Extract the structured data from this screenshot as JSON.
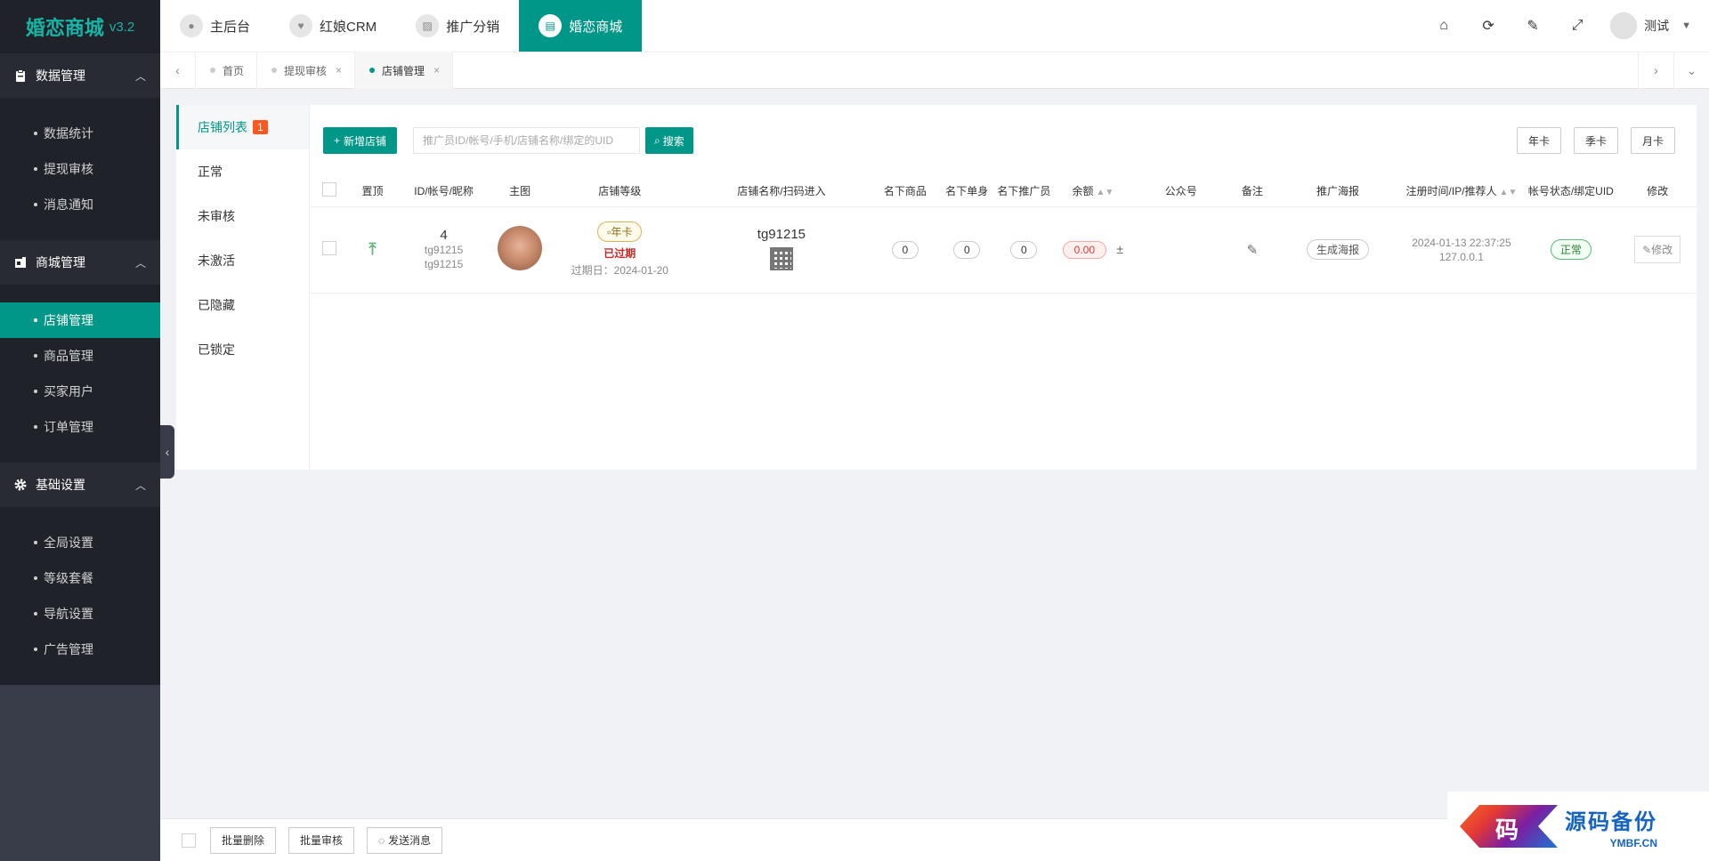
{
  "brand": {
    "name": "婚恋商城",
    "version": "v3.2"
  },
  "sidebar": {
    "groups": [
      {
        "title": "数据管理",
        "icon": "clipboard-icon",
        "items": [
          "数据统计",
          "提现审核",
          "消息通知"
        ]
      },
      {
        "title": "商城管理",
        "icon": "store-icon",
        "items": [
          "店铺管理",
          "商品管理",
          "买家用户",
          "订单管理"
        ],
        "active": "店铺管理"
      },
      {
        "title": "基础设置",
        "icon": "gear-icon",
        "items": [
          "全局设置",
          "等级套餐",
          "导航设置",
          "广告管理"
        ]
      }
    ]
  },
  "topnav": {
    "items": [
      {
        "label": "主后台",
        "icon": "user-circle-icon"
      },
      {
        "label": "红娘CRM",
        "icon": "heart-icon"
      },
      {
        "label": "推广分销",
        "icon": "chart-icon"
      },
      {
        "label": "婚恋商城",
        "icon": "shop-icon",
        "active": true
      }
    ],
    "user_name": "测试"
  },
  "tabs": [
    {
      "label": "首页",
      "closable": false
    },
    {
      "label": "提现审核",
      "closable": true
    },
    {
      "label": "店铺管理",
      "closable": true,
      "active": true
    }
  ],
  "subnav": {
    "items": [
      "店铺列表",
      "正常",
      "未审核",
      "未激活",
      "已隐藏",
      "已锁定"
    ],
    "badge": "1"
  },
  "toolbar": {
    "add_label": "新增店铺",
    "search_placeholder": "推广员ID/帐号/手机/店铺名称/绑定的UID",
    "search_label": "搜索",
    "filters": [
      "年卡",
      "季卡",
      "月卡"
    ]
  },
  "table": {
    "headers": {
      "top": "置顶",
      "id": "ID/帐号/昵称",
      "image": "主图",
      "level": "店铺等级",
      "shop": "店铺名称/扫码进入",
      "goods": "名下商品",
      "singles": "名下单身",
      "promoters": "名下推广员",
      "balance": "余额",
      "wechat": "公众号",
      "remark": "备注",
      "poster": "推广海报",
      "reg": "注册时间/IP/推荐人",
      "status": "帐号状态/绑定UID",
      "edit": "修改"
    },
    "row": {
      "id": "4",
      "account": "tg91215",
      "nickname": "tg91215",
      "level_tag": "年卡",
      "expired": "已过期",
      "expire_date": "过期日：2024-01-20",
      "shop_name": "tg91215",
      "goods": "0",
      "singles": "0",
      "promoters": "0",
      "balance": "0.00",
      "poster_btn": "生成海报",
      "reg_time": "2024-01-13 22:37:25",
      "ip": "127.0.0.1",
      "status": "正常",
      "edit_btn": "修改"
    }
  },
  "bottombar": {
    "buttons": [
      "批量删除",
      "批量审核",
      "发送消息"
    ]
  },
  "watermark": {
    "char": "码",
    "title": "源码备份",
    "sub": "YMBF.CN"
  },
  "colors": {
    "primary": "#009688",
    "sidebar": "#393d49",
    "sidebar_dark": "#20222a",
    "danger": "#e53935",
    "badge": "#ff5722"
  }
}
